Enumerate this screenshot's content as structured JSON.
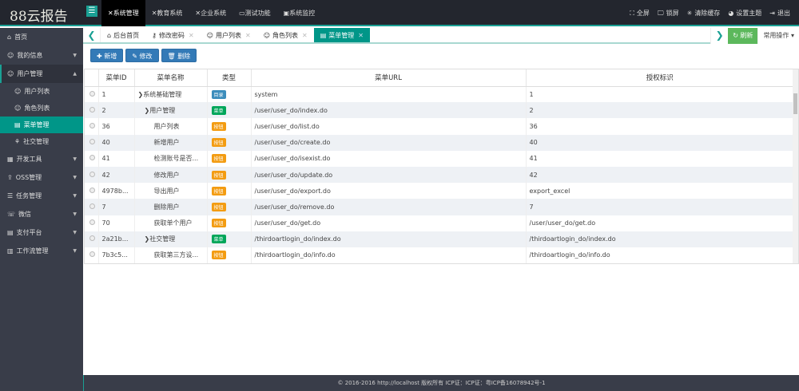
{
  "app": {
    "logo": "88云报告"
  },
  "topnav": [
    {
      "icon": "✕",
      "label": "系统管理",
      "active": true
    },
    {
      "icon": "✕",
      "label": "教育系统"
    },
    {
      "icon": "✕",
      "label": "企业系统"
    },
    {
      "icon": "▭",
      "label": "测试功能"
    },
    {
      "icon": "▣",
      "label": "系统监控"
    }
  ],
  "topright": [
    {
      "icon": "⛶",
      "label": "全屏"
    },
    {
      "icon": "🖵",
      "label": "锁屏"
    },
    {
      "icon": "✳",
      "label": "清除缓存"
    },
    {
      "icon": "◕",
      "label": "设置主题"
    },
    {
      "icon": "⇥",
      "label": "退出"
    }
  ],
  "sidebar": {
    "items": [
      {
        "icon": "⌂",
        "label": "首页"
      },
      {
        "icon": "☺",
        "label": "我的信息",
        "caret": "▼"
      },
      {
        "icon": "☺",
        "label": "用户管理",
        "caret": "▲",
        "open": true
      },
      {
        "icon": "▦",
        "label": "开发工具",
        "caret": "▼"
      },
      {
        "icon": "⇪",
        "label": "OSS管理",
        "caret": "▼"
      },
      {
        "icon": "☰",
        "label": "任务管理",
        "caret": "▼"
      },
      {
        "icon": "☏",
        "label": "微信",
        "caret": "▼"
      },
      {
        "icon": "▤",
        "label": "支付平台",
        "caret": "▼"
      },
      {
        "icon": "▥",
        "label": "工作流管理",
        "caret": "▼"
      }
    ],
    "sub": [
      {
        "icon": "☺",
        "label": "用户列表"
      },
      {
        "icon": "☺",
        "label": "角色列表"
      },
      {
        "icon": "▤",
        "label": "菜单管理",
        "active": true
      },
      {
        "icon": "⚘",
        "label": "社交管理"
      }
    ]
  },
  "tabs": [
    {
      "icon": "⌂",
      "label": "后台首页"
    },
    {
      "icon": "⚷",
      "label": "修改密码",
      "close": "✕"
    },
    {
      "icon": "☺",
      "label": "用户列表",
      "close": "✕"
    },
    {
      "icon": "☺",
      "label": "角色列表",
      "close": "✕"
    },
    {
      "icon": "▤",
      "label": "菜单管理",
      "close": "✕",
      "active": true
    }
  ],
  "tabbar": {
    "refresh": "↻ 刷新",
    "ops": "常用操作 ▾",
    "prev": "❮",
    "next": "❯"
  },
  "toolbar": {
    "add": "✚ 新增",
    "edit": "✎ 修改",
    "del": "🗑 删除"
  },
  "colors": {
    "dir": "#3c8dbc",
    "menu": "#00a65a",
    "btn": "#f39c12"
  },
  "table": {
    "headers": [
      "菜单ID",
      "菜单名称",
      "类型",
      "菜单URL",
      "授权标识"
    ],
    "rows": [
      {
        "id": "1",
        "name": "❯系统基础管理",
        "indent": 0,
        "type": "目录",
        "kind": "dir",
        "url": "system",
        "perm": "1"
      },
      {
        "id": "2",
        "name": "❯用户管理",
        "indent": 1,
        "type": "菜单",
        "kind": "menu",
        "url": "/user/user_do/index.do",
        "perm": "2"
      },
      {
        "id": "36",
        "name": "用户列表",
        "indent": 2,
        "type": "按钮",
        "kind": "btn",
        "url": "/user/user_do/list.do",
        "perm": "36"
      },
      {
        "id": "40",
        "name": "新增用户",
        "indent": 2,
        "type": "按钮",
        "kind": "btn",
        "url": "/user/user_do/create.do",
        "perm": "40"
      },
      {
        "id": "41",
        "name": "检测账号是否...",
        "indent": 2,
        "type": "按钮",
        "kind": "btn",
        "url": "/user/user_do/isexist.do",
        "perm": "41"
      },
      {
        "id": "42",
        "name": "修改用户",
        "indent": 2,
        "type": "按钮",
        "kind": "btn",
        "url": "/user/user_do/update.do",
        "perm": "42"
      },
      {
        "id": "4978b...",
        "name": "导出用户",
        "indent": 2,
        "type": "按钮",
        "kind": "btn",
        "url": "/user/user_do/export.do",
        "perm": "export_excel"
      },
      {
        "id": "7",
        "name": "删除用户",
        "indent": 2,
        "type": "按钮",
        "kind": "btn",
        "url": "/user/user_do/remove.do",
        "perm": "7"
      },
      {
        "id": "70",
        "name": "获取单个用户",
        "indent": 2,
        "type": "按钮",
        "kind": "btn",
        "url": "/user/user_do/get.do",
        "perm": "/user/user_do/get.do"
      },
      {
        "id": "2a21b...",
        "name": "❯社交管理",
        "indent": 1,
        "type": "菜单",
        "kind": "menu",
        "url": "/thirdoartlogin_do/index.do",
        "perm": "/thirdoartlogin_do/index.do"
      },
      {
        "id": "7b3c5...",
        "name": "获取第三方设...",
        "indent": 2,
        "type": "按钮",
        "kind": "btn",
        "url": "/thirdoartlogin_do/info.do",
        "perm": "/thirdoartlogin_do/info.do"
      }
    ]
  },
  "footer": "© 2016-2016 http://localhost 版权所有 ICP证：ICP证：粤ICP备16078942号-1"
}
